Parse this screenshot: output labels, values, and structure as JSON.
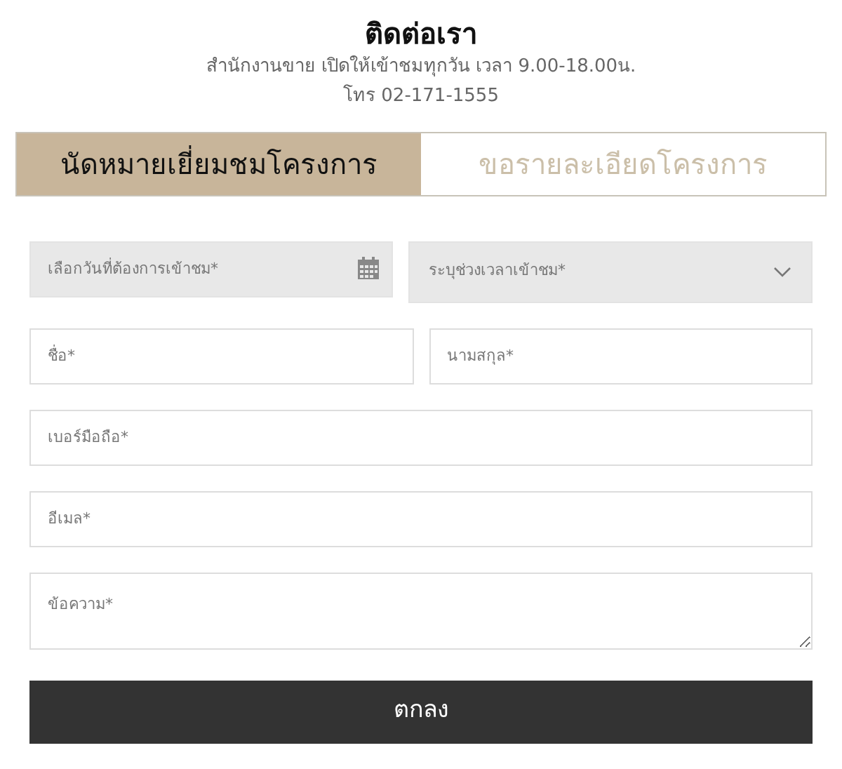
{
  "header": {
    "title": "ติดต่อเรา",
    "subtitle": "สำนักงานขาย เปิดให้เข้าชมทุกวัน เวลา 9.00-18.00น.",
    "phone": "โทร 02-171-1555"
  },
  "tabs": [
    {
      "label": "นัดหมายเยี่ยมชมโครงการ",
      "selected": true
    },
    {
      "label": "ขอรายละเอียดโครงการ",
      "selected": false
    }
  ],
  "rows": [
    [
      {
        "kind": "date",
        "placeholder": "เลือกวันที่ต้องการเข้าชม*"
      },
      {
        "kind": "select",
        "placeholder": "ระบุช่วงเวลาเข้าชม*"
      }
    ],
    [
      {
        "kind": "text",
        "placeholder": "ชื่อ*"
      },
      {
        "kind": "text",
        "placeholder": "นามสกุล*"
      }
    ],
    [
      {
        "kind": "text",
        "placeholder": "เบอร์มือถือ*"
      }
    ],
    [
      {
        "kind": "text",
        "placeholder": "อีเมล*"
      }
    ],
    [
      {
        "kind": "textarea",
        "placeholder": "ข้อความ*"
      }
    ]
  ],
  "submit": "ตกลง"
}
